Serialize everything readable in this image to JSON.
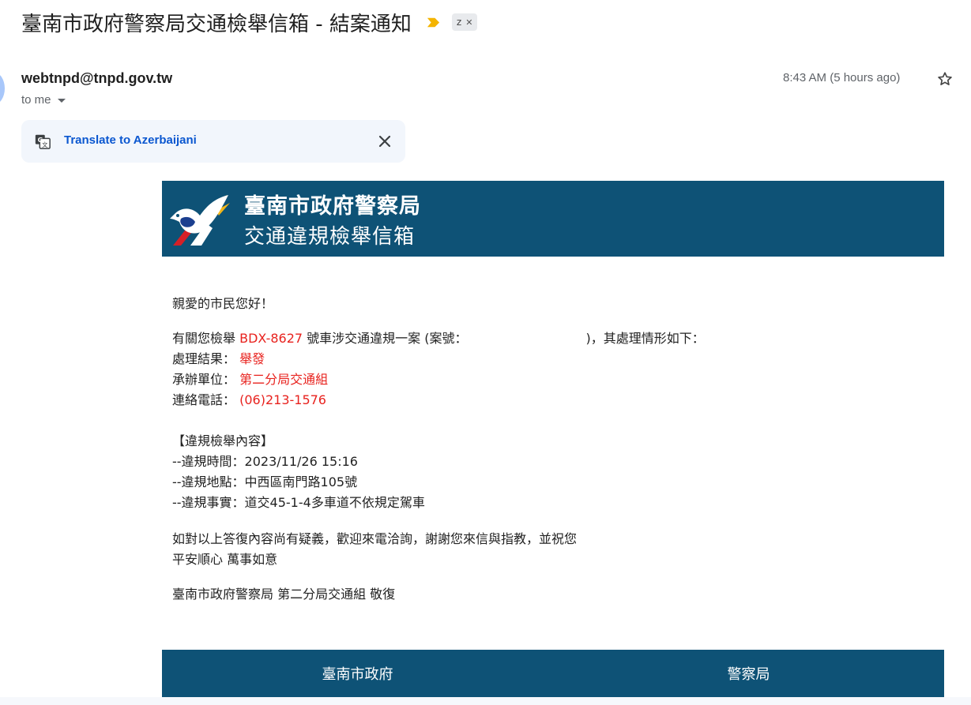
{
  "email": {
    "subject": "臺南市政府警察局交通檢舉信箱 - 結案通知",
    "label_chip": "z",
    "sender": "webtnpd@tnpd.gov.tw",
    "to": "to me",
    "timestamp": "8:43 AM (5 hours ago)"
  },
  "translate": {
    "link": "Translate to Azerbaijani"
  },
  "banner": {
    "title": "臺南市政府警察局",
    "subtitle": "交通違規檢舉信箱"
  },
  "body": {
    "greeting": "親愛的市民您好！",
    "report_prefix": "有關您檢舉",
    "plate": "BDX-8627",
    "report_mid": "號車涉交通違規一案 (案號：",
    "report_suffix": ")，其處理情形如下：",
    "result_label": "處理結果：",
    "result_value": "舉發",
    "unit_label": "承辦單位：",
    "unit_value": "第二分局交通組",
    "phone_label": "連絡電話：",
    "phone_value": "(06)213-1576",
    "section_title": "【違規檢舉內容】",
    "violation_time": "--違規時間：2023/11/26 15:16",
    "violation_place": "--違規地點：中西區南門路105號",
    "violation_fact": "--違規事實：道交45-1-4多車道不依規定駕車",
    "closing_1": "如對以上答復內容尚有疑義，歡迎來電洽詢，謝謝您來信與指教，並祝您",
    "closing_2": "平安順心 萬事如意",
    "signature": "臺南市政府警察局 第二分局交通組 敬復"
  },
  "footer": {
    "left": "臺南市政府",
    "right": "警察局"
  },
  "colors": {
    "banner_bg": "#0e5276",
    "highlight_red": "#e8221e",
    "link_blue": "#0b57d0",
    "importance_yellow": "#f4b400"
  }
}
